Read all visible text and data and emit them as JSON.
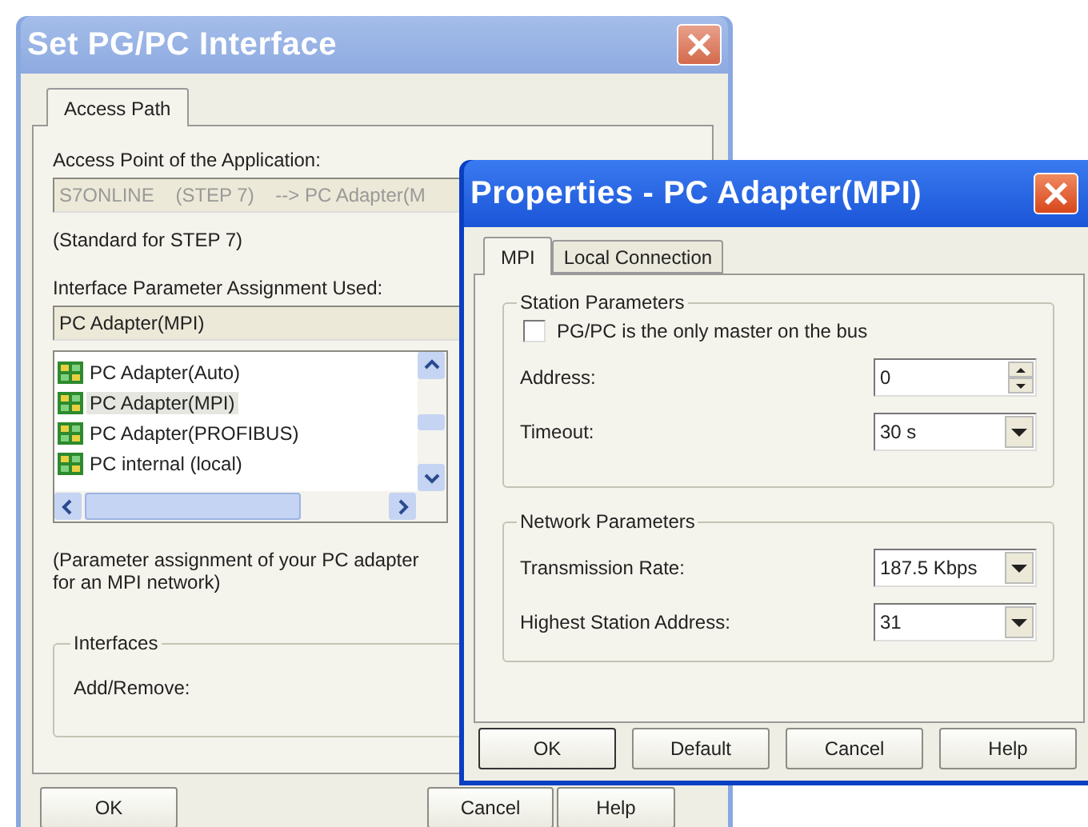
{
  "main_dialog": {
    "title": "Set PG/PC Interface",
    "tabs": [
      {
        "label": "Access Path",
        "selected": true
      }
    ],
    "access_point": {
      "label": "Access Point of the Application:",
      "value": "S7ONLINE    (STEP 7)    --> PC Adapter(M",
      "disabled": true
    },
    "access_point_note": "(Standard for STEP 7)",
    "assignment": {
      "label": "Interface Parameter Assignment Used:",
      "value": "PC Adapter(MPI)"
    },
    "assignments_list": [
      {
        "label": "PC Adapter(Auto)",
        "selected": false
      },
      {
        "label": "PC Adapter(MPI)",
        "selected": true
      },
      {
        "label": "PC Adapter(PROFIBUS)",
        "selected": false
      },
      {
        "label": "PC internal (local)",
        "selected": false
      }
    ],
    "description": "(Parameter assignment of your PC adapter for an MPI network)",
    "interfaces": {
      "title": "Interfaces",
      "label": "Add/Remove:"
    },
    "buttons": [
      "OK",
      "Cancel",
      "Help"
    ]
  },
  "properties_dialog": {
    "title": "Properties - PC Adapter(MPI)",
    "tabs": [
      {
        "label": "MPI",
        "selected": true
      },
      {
        "label": "Local Connection",
        "selected": false
      }
    ],
    "station_parameters": {
      "title": "Station Parameters",
      "only_master": {
        "label": "PG/PC is the only master on the bus",
        "checked": false
      },
      "fields": [
        {
          "kind": "spin",
          "label": "Address:",
          "value": "0"
        },
        {
          "kind": "dropdown",
          "label": "Timeout:",
          "value": "30 s"
        }
      ]
    },
    "network_parameters": {
      "title": "Network Parameters",
      "fields": [
        {
          "kind": "dropdown",
          "label": "Transmission Rate:",
          "value": "187.5 Kbps"
        },
        {
          "kind": "dropdown",
          "label": "Highest Station Address:",
          "value": "31"
        }
      ]
    },
    "buttons": [
      "OK",
      "Default",
      "Cancel",
      "Help"
    ]
  }
}
